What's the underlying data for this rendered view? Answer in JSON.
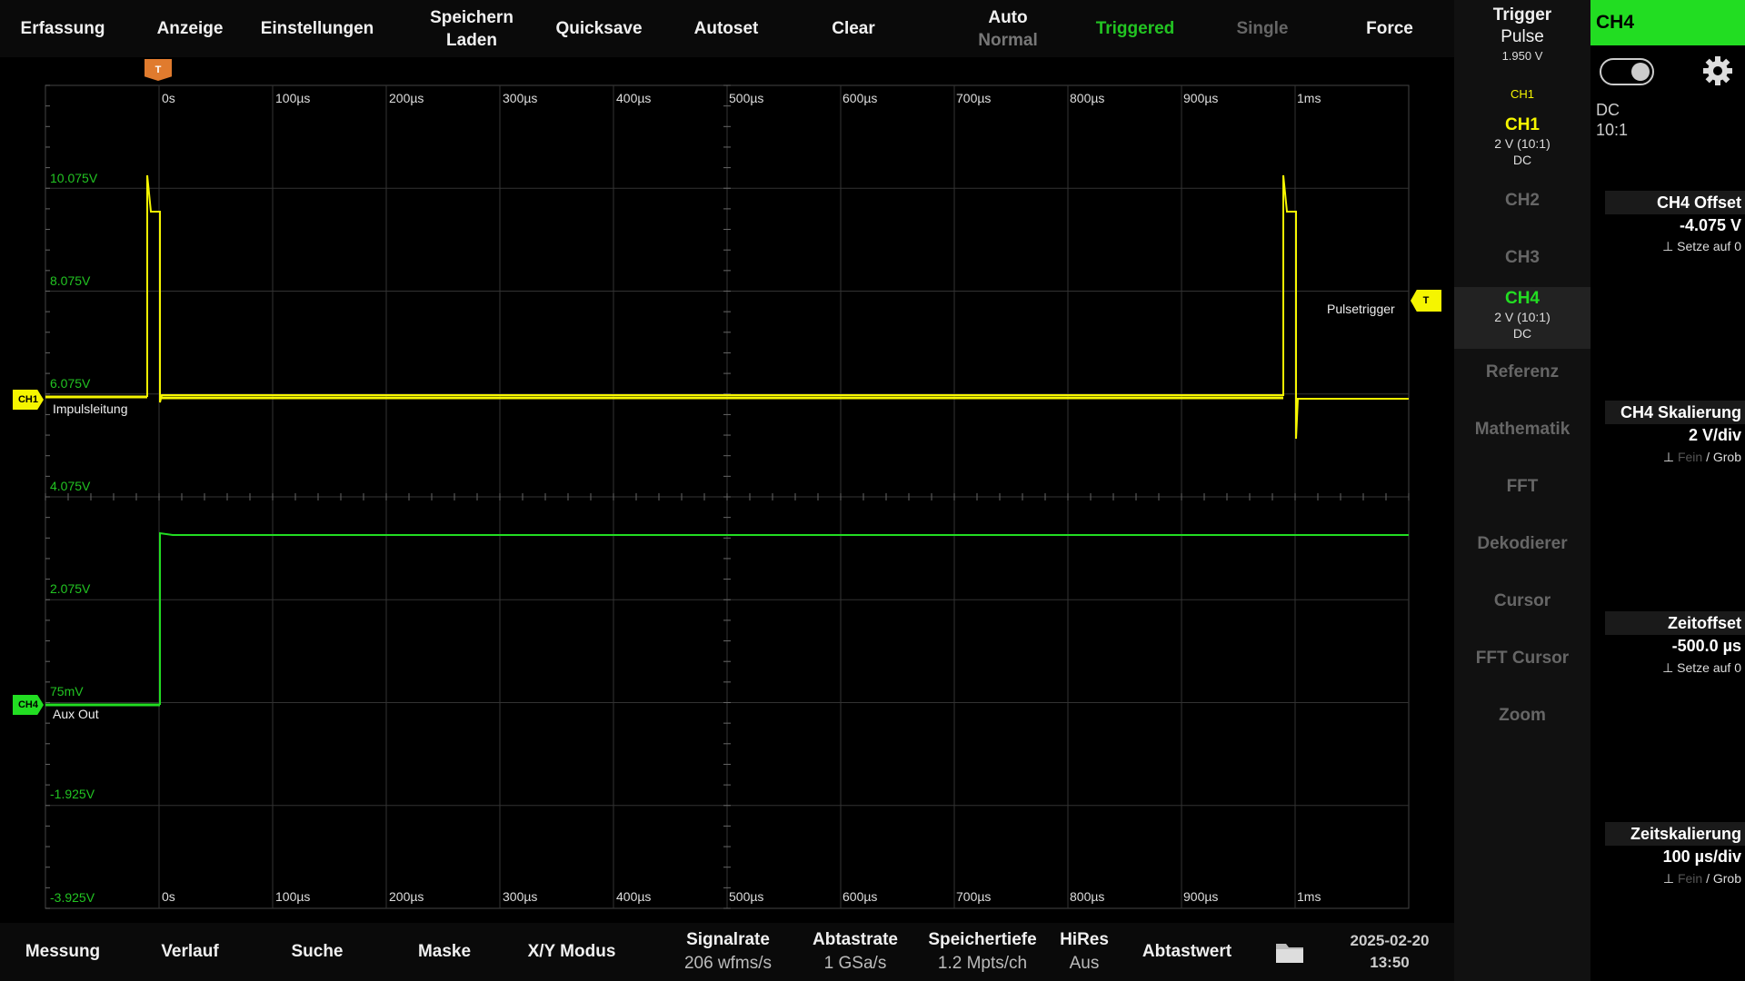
{
  "topbar": {
    "erfassung": "Erfassung",
    "anzeige": "Anzeige",
    "einstellungen": "Einstellungen",
    "speichern": "Speichern",
    "laden": "Laden",
    "quicksave": "Quicksave",
    "autoset": "Autoset",
    "clear": "Clear",
    "auto": "Auto",
    "normal": "Normal",
    "triggered": "Triggered",
    "single": "Single",
    "force": "Force"
  },
  "trigger_panel": {
    "title": "Trigger",
    "type": "Pulse",
    "level": "1.950 V",
    "source": "CH1"
  },
  "channels": {
    "ch1": {
      "name": "CH1",
      "scale": "2 V (10:1)",
      "coupling": "DC"
    },
    "ch2": {
      "name": "CH2"
    },
    "ch3": {
      "name": "CH3"
    },
    "ch4": {
      "name": "CH4",
      "scale": "2 V (10:1)",
      "coupling": "DC"
    },
    "referenz": "Referenz",
    "mathematik": "Mathematik",
    "fft": "FFT",
    "dekodierer": "Dekodierer",
    "cursor": "Cursor",
    "fft_cursor": "FFT Cursor",
    "zoom": "Zoom"
  },
  "settings": {
    "title": "CH4",
    "coupling": "DC",
    "probe": "10:1",
    "offset_label": "CH4 Offset",
    "offset_value": "-4.075 V",
    "offset_hint": "Setze auf 0",
    "scale_label": "CH4 Skalierung",
    "scale_value": "2 V/div",
    "fein": "Fein",
    "grob": "/ Grob",
    "zeitoffset_label": "Zeitoffset",
    "zeitoffset_value": "-500.0 µs",
    "zeitoffset_hint": "Setze auf 0",
    "zeitskal_label": "Zeitskalierung",
    "zeitskal_value": "100 µs/div",
    "fein2": "Fein",
    "grob2": "/ Grob"
  },
  "scope": {
    "volt_labels": [
      "10.075V",
      "8.075V",
      "6.075V",
      "4.075V",
      "2.075V",
      "75mV",
      "-1.925V",
      "-3.925V"
    ],
    "time_labels": [
      "0s",
      "100µs",
      "200µs",
      "300µs",
      "400µs",
      "500µs",
      "600µs",
      "700µs",
      "800µs",
      "900µs",
      "1ms"
    ],
    "trigger_marker": "T",
    "ch1_marker": "CH1",
    "ch1_label": "Impulsleitung",
    "ch4_marker": "CH4",
    "ch4_label": "Aux Out",
    "pulsetrigger": "Pulsetrigger",
    "trig_level_marker": "T"
  },
  "bottombar": {
    "messung": "Messung",
    "verlauf": "Verlauf",
    "suche": "Suche",
    "maske": "Maske",
    "xy": "X/Y Modus",
    "signalrate_label": "Signalrate",
    "signalrate_value": "206 wfms/s",
    "abtastrate_label": "Abtastrate",
    "abtastrate_value": "1 GSa/s",
    "speichertiefe_label": "Speichertiefe",
    "speichertiefe_value": "1.2 Mpts/ch",
    "hires_label": "HiRes",
    "hires_value": "Aus",
    "abtastwert": "Abtastwert",
    "date": "2025-02-20",
    "time": "13:50"
  },
  "colors": {
    "ch1": "#f5f500",
    "ch4": "#22dd22",
    "trigger_marker": "#e07b2e"
  }
}
